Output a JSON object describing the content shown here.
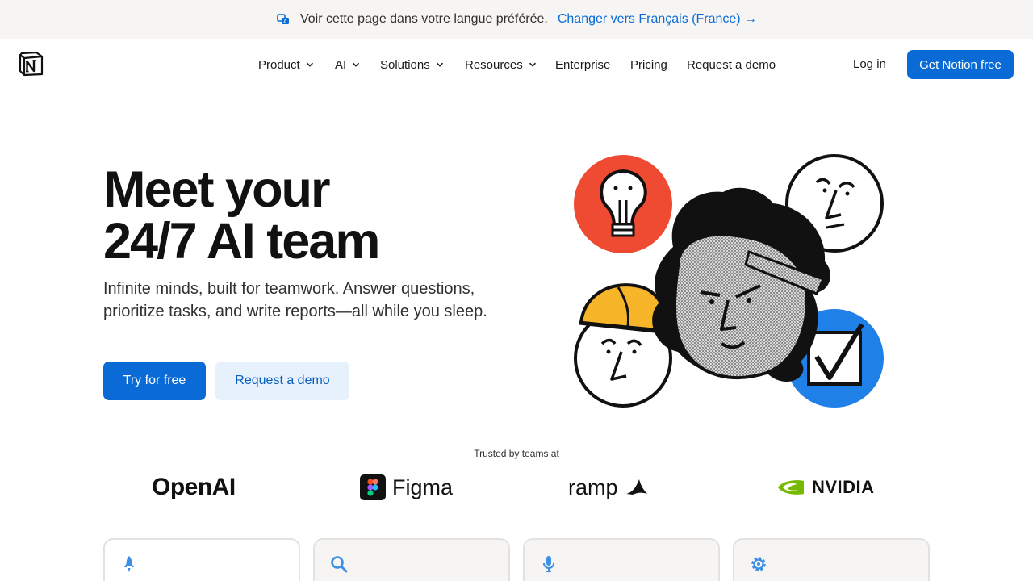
{
  "banner": {
    "message": "Voir cette page dans votre langue préférée.",
    "switch_label": "Changer vers Français (France) →",
    "icon": "translate-icon"
  },
  "nav": {
    "logo": "notion-logo",
    "items": [
      {
        "label": "Product",
        "has_dropdown": true
      },
      {
        "label": "AI",
        "has_dropdown": true
      },
      {
        "label": "Solutions",
        "has_dropdown": true
      },
      {
        "label": "Resources",
        "has_dropdown": true
      },
      {
        "label": "Enterprise",
        "has_dropdown": false
      },
      {
        "label": "Pricing",
        "has_dropdown": false
      },
      {
        "label": "Request a demo",
        "has_dropdown": false
      }
    ],
    "login_label": "Log in",
    "cta_label": "Get Notion free"
  },
  "hero": {
    "title_line1": "Meet your",
    "title_line2": "24/7 AI team",
    "subtitle": "Infinite minds, built for teamwork. Answer questions, prioritize tasks, and write reports—all while you sleep.",
    "primary_button": "Try for free",
    "secondary_button": "Request a demo"
  },
  "trusted": {
    "label": "Trusted by teams at",
    "logos": [
      "OpenAI",
      "Figma",
      "ramp",
      "NVIDIA"
    ]
  },
  "cards": [
    {
      "icon": "rocket-icon"
    },
    {
      "icon": "search-icon"
    },
    {
      "icon": "microphone-icon"
    },
    {
      "icon": "gear-icon"
    }
  ],
  "colors": {
    "accent": "#0a6bd6",
    "accent_light": "#e6f1fc",
    "banner_bg": "#f6f5f4",
    "illustration_red": "#ef4b33",
    "illustration_blue": "#1f80e8",
    "illustration_yellow": "#f7b52a"
  }
}
